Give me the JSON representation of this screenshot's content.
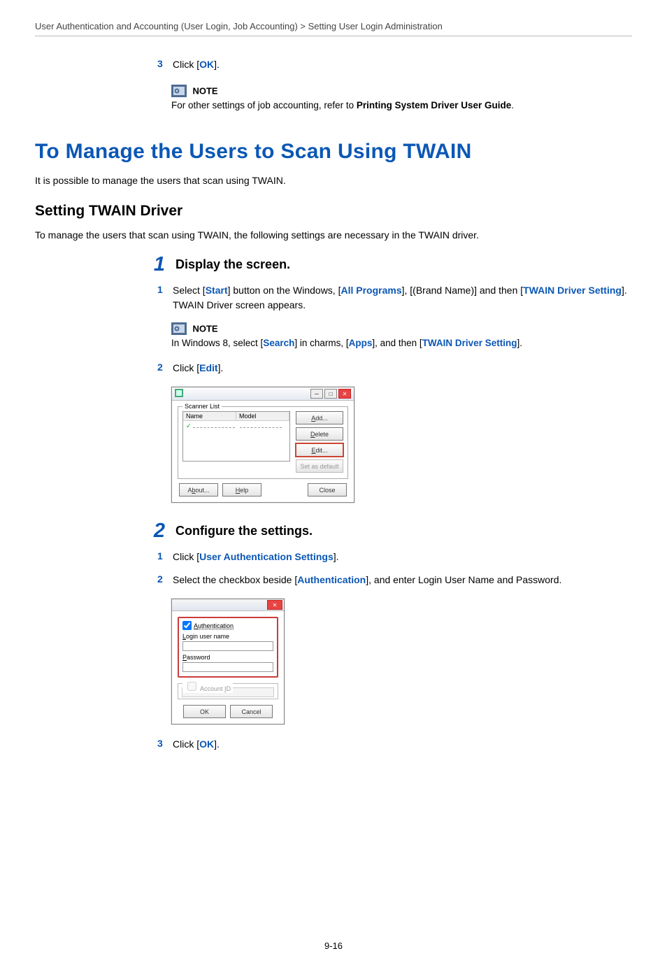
{
  "breadcrumb": "User Authentication and Accounting (User Login, Job Accounting) > Setting User Login Administration",
  "top": {
    "step3_num": "3",
    "step3_prefix": "Click [",
    "step3_link": "OK",
    "step3_suffix": "].",
    "note_label": "NOTE",
    "note_body_a": "For other settings of job accounting, refer to ",
    "note_body_b": "Printing System Driver User Guide",
    "note_body_c": "."
  },
  "section_title": "To Manage the Users to Scan Using TWAIN",
  "intro": "It is possible to manage the users that scan using TWAIN.",
  "subsection": "Setting TWAIN Driver",
  "subintro": "To manage the users that scan using TWAIN, the following settings are necessary in the TWAIN driver.",
  "step1": {
    "num": "1",
    "title": "Display the screen.",
    "s1": {
      "num": "1",
      "a": "Select [",
      "start": "Start",
      "b": "] button on the Windows, [",
      "allprog": "All Programs",
      "c": "], [(Brand Name)] and then [",
      "tds": "TWAIN Driver Setting",
      "d": "]. TWAIN Driver screen appears."
    },
    "note_label": "NOTE",
    "note_a": "In Windows 8, select [",
    "note_search": "Search",
    "note_b": "] in charms, [",
    "note_apps": "Apps",
    "note_c": "], and then [",
    "note_tds": "TWAIN Driver Setting",
    "note_d": "].",
    "s2": {
      "num": "2",
      "a": "Click [",
      "edit": "Edit",
      "b": "]."
    }
  },
  "dlg1": {
    "scanner_list": "Scanner List",
    "col_name": "Name",
    "col_model": "Model",
    "add": "Add...",
    "delete": "Delete",
    "edit": "Edit...",
    "setdef": "Set as default",
    "about": "About...",
    "help": "Help",
    "close": "Close"
  },
  "step2": {
    "num": "2",
    "title": "Configure the settings.",
    "s1": {
      "num": "1",
      "a": "Click [",
      "link": "User Authentication Settings",
      "b": "]."
    },
    "s2": {
      "num": "2",
      "a": "Select the checkbox beside [",
      "link": "Authentication",
      "b": "], and enter Login User Name and Password."
    },
    "s3": {
      "num": "3",
      "a": "Click [",
      "link": "OK",
      "b": "]."
    }
  },
  "dlg2": {
    "auth": "Authentication",
    "lun": "Login user name",
    "pwd": "Password",
    "acct": "Account ID",
    "ok": "OK",
    "cancel": "Cancel"
  },
  "pagenum": "9-16"
}
